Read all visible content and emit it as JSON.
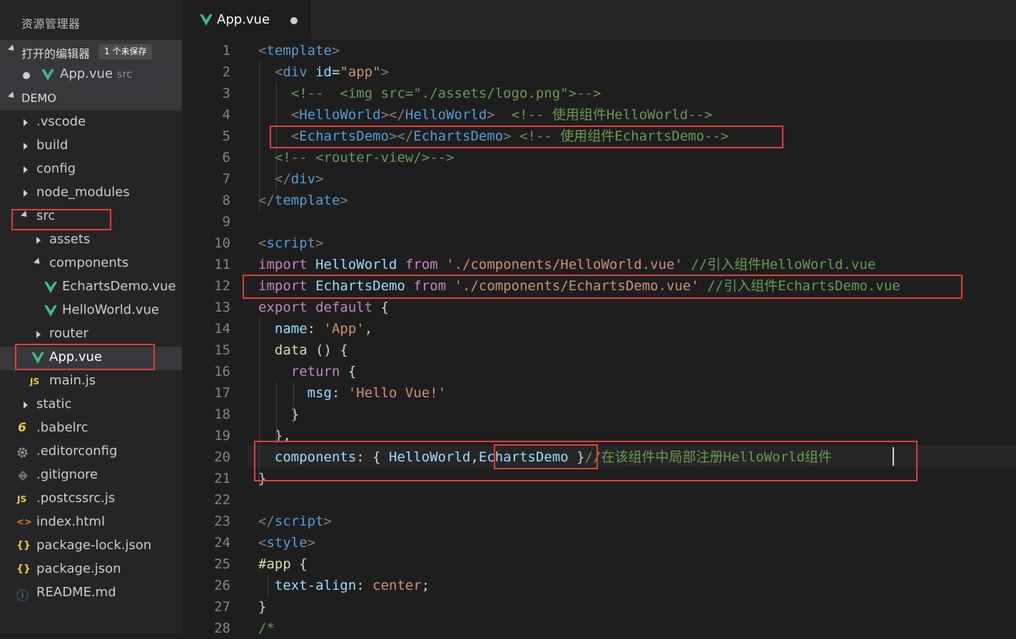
{
  "sidebar": {
    "title": "资源管理器",
    "open_editors": {
      "label": "打开的编辑器",
      "badge": "1 个未保存",
      "items": [
        {
          "name": "App.vue",
          "dir": "src"
        }
      ]
    },
    "project": {
      "label": "DEMO"
    },
    "tree": [
      {
        "name": ".vscode",
        "kind": "folder"
      },
      {
        "name": "build",
        "kind": "folder"
      },
      {
        "name": "config",
        "kind": "folder"
      },
      {
        "name": "node_modules",
        "kind": "folder"
      },
      {
        "name": "src",
        "kind": "folder-open"
      },
      {
        "name": "assets",
        "kind": "folder"
      },
      {
        "name": "components",
        "kind": "folder-open"
      },
      {
        "name": "EchartsDemo.vue",
        "kind": "vue"
      },
      {
        "name": "HelloWorld.vue",
        "kind": "vue"
      },
      {
        "name": "router",
        "kind": "folder"
      },
      {
        "name": "App.vue",
        "kind": "vue"
      },
      {
        "name": "main.js",
        "kind": "js",
        "icon": "JS"
      },
      {
        "name": "static",
        "kind": "folder"
      },
      {
        "name": ".babelrc",
        "kind": "babel",
        "icon": "6"
      },
      {
        "name": ".editorconfig",
        "kind": "gear"
      },
      {
        "name": ".gitignore",
        "kind": "git"
      },
      {
        "name": ".postcssrc.js",
        "kind": "js",
        "icon": "JS"
      },
      {
        "name": "index.html",
        "kind": "html",
        "icon": "<>"
      },
      {
        "name": "package-lock.json",
        "kind": "json",
        "icon": "{}"
      },
      {
        "name": "package.json",
        "kind": "json",
        "icon": "{}"
      },
      {
        "name": "README.md",
        "kind": "info",
        "icon": "ⓘ"
      }
    ]
  },
  "tab": {
    "label": "App.vue"
  },
  "editor": {
    "lines": [
      [
        [
          "p",
          "<"
        ],
        [
          "t",
          "template"
        ],
        [
          "p",
          ">"
        ]
      ],
      [
        [
          "p",
          "  <"
        ],
        [
          "t",
          "div"
        ],
        [
          "w",
          " "
        ],
        [
          "a",
          "id"
        ],
        [
          "w",
          "="
        ],
        [
          "s",
          "\"app\""
        ],
        [
          "p",
          ">"
        ]
      ],
      [
        [
          "c",
          "    <!--  <img src=\"./assets/logo.png\">-->"
        ]
      ],
      [
        [
          "p",
          "    <"
        ],
        [
          "t",
          "HelloWorld"
        ],
        [
          "p",
          "></"
        ],
        [
          "t",
          "HelloWorld"
        ],
        [
          "p",
          ">"
        ],
        [
          "c",
          "  <!-- 使用组件HelloWorld-->"
        ]
      ],
      [
        [
          "p",
          "    <"
        ],
        [
          "t",
          "EchartsDemo"
        ],
        [
          "p",
          "></"
        ],
        [
          "t",
          "EchartsDemo"
        ],
        [
          "p",
          ">"
        ],
        [
          "c",
          " <!-- 使用组件EchartsDemo-->"
        ]
      ],
      [
        [
          "c",
          "  <!-- <router-view/>-->"
        ]
      ],
      [
        [
          "p",
          "  </"
        ],
        [
          "t",
          "div"
        ],
        [
          "p",
          ">"
        ]
      ],
      [
        [
          "p",
          "</"
        ],
        [
          "t",
          "template"
        ],
        [
          "p",
          ">"
        ]
      ],
      [],
      [
        [
          "p",
          "<"
        ],
        [
          "t",
          "script"
        ],
        [
          "p",
          ">"
        ]
      ],
      [
        [
          "i",
          "import"
        ],
        [
          "w",
          " "
        ],
        [
          "v",
          "HelloWorld"
        ],
        [
          "w",
          " "
        ],
        [
          "i",
          "from"
        ],
        [
          "w",
          " "
        ],
        [
          "s",
          "'./components/HelloWorld.vue'"
        ],
        [
          "w",
          " "
        ],
        [
          "c",
          "//引入组件HelloWorld.vue"
        ]
      ],
      [
        [
          "i",
          "import"
        ],
        [
          "w",
          " "
        ],
        [
          "v",
          "EchartsDemo"
        ],
        [
          "w",
          " "
        ],
        [
          "i",
          "from"
        ],
        [
          "w",
          " "
        ],
        [
          "s",
          "'./components/EchartsDemo.vue'"
        ],
        [
          "w",
          " "
        ],
        [
          "c",
          "//引入组件EchartsDemo.vue"
        ]
      ],
      [
        [
          "i",
          "export"
        ],
        [
          "w",
          " "
        ],
        [
          "i",
          "default"
        ],
        [
          "w",
          " {"
        ]
      ],
      [
        [
          "w",
          "  "
        ],
        [
          "v",
          "name"
        ],
        [
          "w",
          ": "
        ],
        [
          "s",
          "'App'"
        ],
        [
          "w",
          ","
        ]
      ],
      [
        [
          "w",
          "  "
        ],
        [
          "fn",
          "data"
        ],
        [
          "w",
          " () {"
        ]
      ],
      [
        [
          "w",
          "    "
        ],
        [
          "i",
          "return"
        ],
        [
          "w",
          " {"
        ]
      ],
      [
        [
          "w",
          "      "
        ],
        [
          "v",
          "msg"
        ],
        [
          "w",
          ": "
        ],
        [
          "s",
          "'Hello Vue!'"
        ]
      ],
      [
        [
          "w",
          "    }"
        ]
      ],
      [
        [
          "w",
          "  },"
        ]
      ],
      [
        [
          "w",
          "  "
        ],
        [
          "v",
          "components"
        ],
        [
          "w",
          ": { "
        ],
        [
          "v",
          "HelloWorld"
        ],
        [
          "w",
          ","
        ],
        [
          "v",
          "EchartsDemo"
        ],
        [
          "w",
          " }"
        ],
        [
          "c",
          "//在该组件中局部注册HelloWorld组件"
        ]
      ],
      [
        [
          "w",
          "}"
        ]
      ],
      [],
      [
        [
          "p",
          "</"
        ],
        [
          "t",
          "script"
        ],
        [
          "p",
          ">"
        ]
      ],
      [
        [
          "p",
          "<"
        ],
        [
          "t",
          "style"
        ],
        [
          "p",
          ">"
        ]
      ],
      [
        [
          "fn",
          "#app"
        ],
        [
          "w",
          " {"
        ]
      ],
      [
        [
          "w",
          "  "
        ],
        [
          "v",
          "text-align"
        ],
        [
          "w",
          ": "
        ],
        [
          "s",
          "center"
        ],
        [
          "w",
          ";"
        ]
      ],
      [
        [
          "w",
          "}"
        ]
      ],
      [
        [
          "c",
          "/*"
        ]
      ]
    ]
  }
}
